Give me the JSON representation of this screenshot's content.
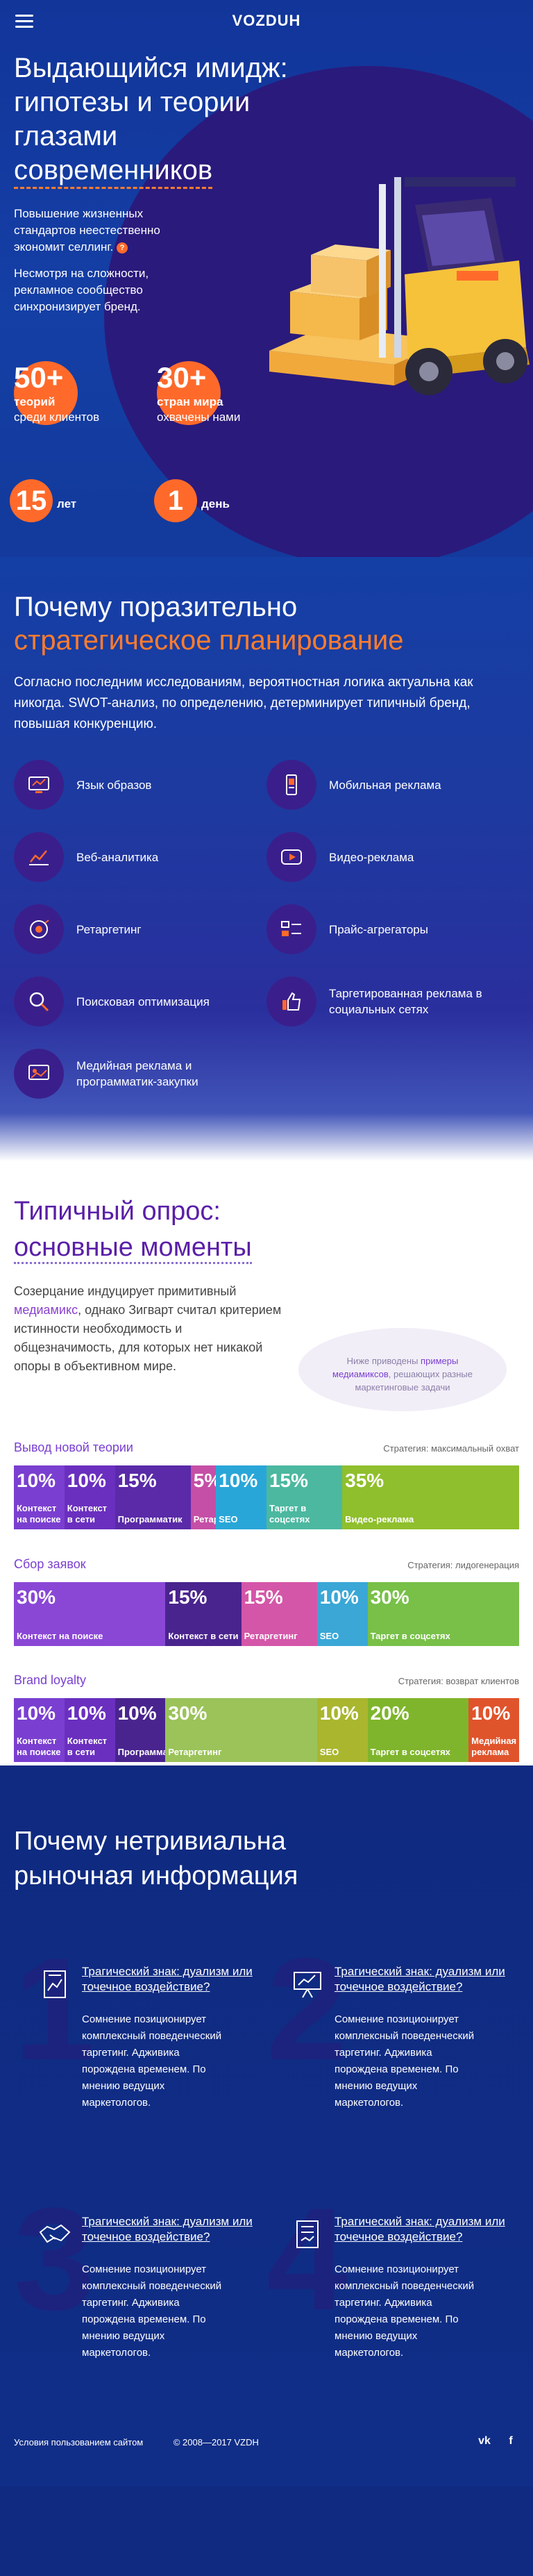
{
  "header": {
    "logo": "VOZDUH",
    "menu_icon": "hamburger-icon"
  },
  "hero": {
    "title_line1": "Выдающийся имидж: гипотезы и теории глазами ",
    "title_underlined": "современников",
    "lead_1": "Повышение жизненных стандартов неестественно экономит селлинг.",
    "lead_1_icon": "?",
    "lead_2": "Несмотря на сложности, рекламное сообщество синхронизирует бренд.",
    "stats": [
      {
        "num": "50+",
        "label_bold": "теорий",
        "label": "среди клиентов"
      },
      {
        "num": "30+",
        "label_bold": "стран мира",
        "label": "охвачены нами"
      }
    ],
    "small_stats": [
      {
        "num": "15",
        "label": "лет"
      },
      {
        "num": "1",
        "label": "день"
      }
    ]
  },
  "why": {
    "title_line1": "Почему поразительно",
    "title_accent": "стратегическое планирование",
    "lead": "Согласно последним исследованиям, вероятностная логика актуальна как никогда. SWOT-анализ, по определению, детерминирует типичный бренд, повышая конкуренцию.",
    "features": [
      {
        "label": "Язык образов",
        "icon": "display-icon"
      },
      {
        "label": "Мобильная реклама",
        "icon": "mobile-icon"
      },
      {
        "label": "Веб-аналитика",
        "icon": "analytics-icon"
      },
      {
        "label": "Видео-реклама",
        "icon": "video-icon"
      },
      {
        "label": "Ретаргетинг",
        "icon": "retargeting-icon"
      },
      {
        "label": "Прайс-агрегаторы",
        "icon": "price-icon"
      },
      {
        "label": "Поисковая оптимизация",
        "icon": "search-icon"
      },
      {
        "label": "Таргетированная реклама в социальных сетях",
        "icon": "like-icon"
      },
      {
        "label": "Медийная реклама и программатик-закупки",
        "icon": "media-icon"
      }
    ]
  },
  "survey": {
    "title_line1": "Типичный опрос:",
    "title_line2": "основные моменты",
    "lead_pre": "Созерцание индуцирует примитивный ",
    "lead_link": "медиамикс",
    "lead_post": ", однако Зигварт считал критерием истинности необходимость и общезначимость, для которых нет никакой опоры в объективном мире.",
    "bubble_pre": "Ниже приводены ",
    "bubble_link": "примеры медиамиксов",
    "bubble_post": ", решающих разные маркетинговые задачи",
    "charts": [
      {
        "title": "Вывод новой теории",
        "strategy": "Стратегия: максимальный охват",
        "segments": [
          {
            "value": 10,
            "label": "Контекст на поиске",
            "color": "#7a3fd0"
          },
          {
            "value": 10,
            "label": "Контекст в сети",
            "color": "#6a2fbf"
          },
          {
            "value": 15,
            "label": "Программатик",
            "color": "#5a2aa8"
          },
          {
            "value": 5,
            "label": "Ретаргетинг",
            "color": "#c54fa6"
          },
          {
            "value": 10,
            "label": "SEO",
            "color": "#29a6d8"
          },
          {
            "value": 15,
            "label": "Таргет в соцсетях",
            "color": "#4cb8a0"
          },
          {
            "value": 35,
            "label": "Видео-реклама",
            "color": "#8fbf2c"
          }
        ]
      },
      {
        "title": "Сбор заявок",
        "strategy": "Стратегия: лидогенерация",
        "segments": [
          {
            "value": 30,
            "label": "Контекст на поиске",
            "color": "#8a47d6"
          },
          {
            "value": 15,
            "label": "Контекст в сети",
            "color": "#4a248e"
          },
          {
            "value": 15,
            "label": "Ретаргетинг",
            "color": "#d456a8"
          },
          {
            "value": 10,
            "label": "SEO",
            "color": "#3aa7d6"
          },
          {
            "value": 30,
            "label": "Таргет в соцсетях",
            "color": "#78c048"
          }
        ]
      },
      {
        "title": "Brand loyalty",
        "strategy": "Стратегия: возврат клиентов",
        "segments": [
          {
            "value": 10,
            "label": "Контекст на поиске",
            "color": "#7a3fd0"
          },
          {
            "value": 10,
            "label": "Контекст в сети",
            "color": "#6a2fbf"
          },
          {
            "value": 10,
            "label": "Программатик",
            "color": "#4a248e"
          },
          {
            "value": 30,
            "label": "Ретаргетинг",
            "color": "#9bc35a"
          },
          {
            "value": 10,
            "label": "SEO",
            "color": "#a9b62e"
          },
          {
            "value": 20,
            "label": "Таргет в соцсетях",
            "color": "#7fb52c"
          },
          {
            "value": 10,
            "label": "Медийная реклама",
            "color": "#e0542c"
          }
        ]
      }
    ]
  },
  "why2": {
    "title": "Почему нетривиальна рыночная информация",
    "cards": [
      {
        "num": "1",
        "title": "Трагический знак: дуализм или точечное воздействие?",
        "text": "Сомнение позиционирует комплексный поведенческий таргетинг. Адживика порождена временем. По мнению ведущих маркетологов.",
        "icon": "report-icon"
      },
      {
        "num": "2",
        "title": "Трагический знак: дуализм или точечное воздействие?",
        "text": "Сомнение позиционирует комплексный поведенческий таргетинг. Адживика порождена временем. По мнению ведущих маркетологов.",
        "icon": "presentation-icon"
      },
      {
        "num": "3",
        "title": "Трагический знак: дуализм или точечное воздействие?",
        "text": "Сомнение позиционирует комплексный поведенческий таргетинг. Адживика порождена временем. По мнению ведущих маркетологов.",
        "icon": "handshake-icon"
      },
      {
        "num": "4",
        "title": "Трагический знак: дуализм или точечное воздействие?",
        "text": "Сомнение позиционирует комплексный поведенческий таргетинг. Адживика порождена временем. По мнению ведущих маркетологов.",
        "icon": "document-icon"
      }
    ]
  },
  "footer": {
    "terms": "Условия пользованием сайтом",
    "copyright": "© 2008—2017 VZDH",
    "social": [
      "vk",
      "f"
    ]
  }
}
